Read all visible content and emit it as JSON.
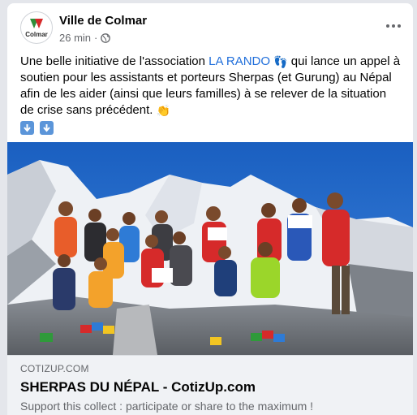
{
  "post": {
    "author": "Ville de Colmar",
    "avatar_label": "Colmar",
    "time": "26 min",
    "separator": "·",
    "privacy_icon": "globe-icon",
    "menu_icon": "more-options-icon",
    "text_before_link": "Une belle initiative de l'association ",
    "link_text": "LA RANDO",
    "emoji_feet": "👣",
    "text_after_link": " qui lance un appel à soutien pour les assistants et porteurs Sherpas (et Gurung) au Népal afin de les aider (ainsi que leurs familles) à se relever de la situation de crise sans précédent. ",
    "emoji_clap": "👏",
    "down_icons": [
      "down-arrow-icon",
      "down-arrow-icon"
    ]
  },
  "photo": {
    "description_icon": "group-photo-mountain"
  },
  "link_preview": {
    "domain": "COTIZUP.COM",
    "title": "SHERPAS DU NÉPAL - CotizUp.com",
    "description": "Support this collect : participate or share to the maximum !"
  },
  "colors": {
    "link": "#216fdb",
    "secondary_text": "#65676b",
    "preview_bg": "#f0f2f5",
    "sky": "#1f67c8"
  }
}
